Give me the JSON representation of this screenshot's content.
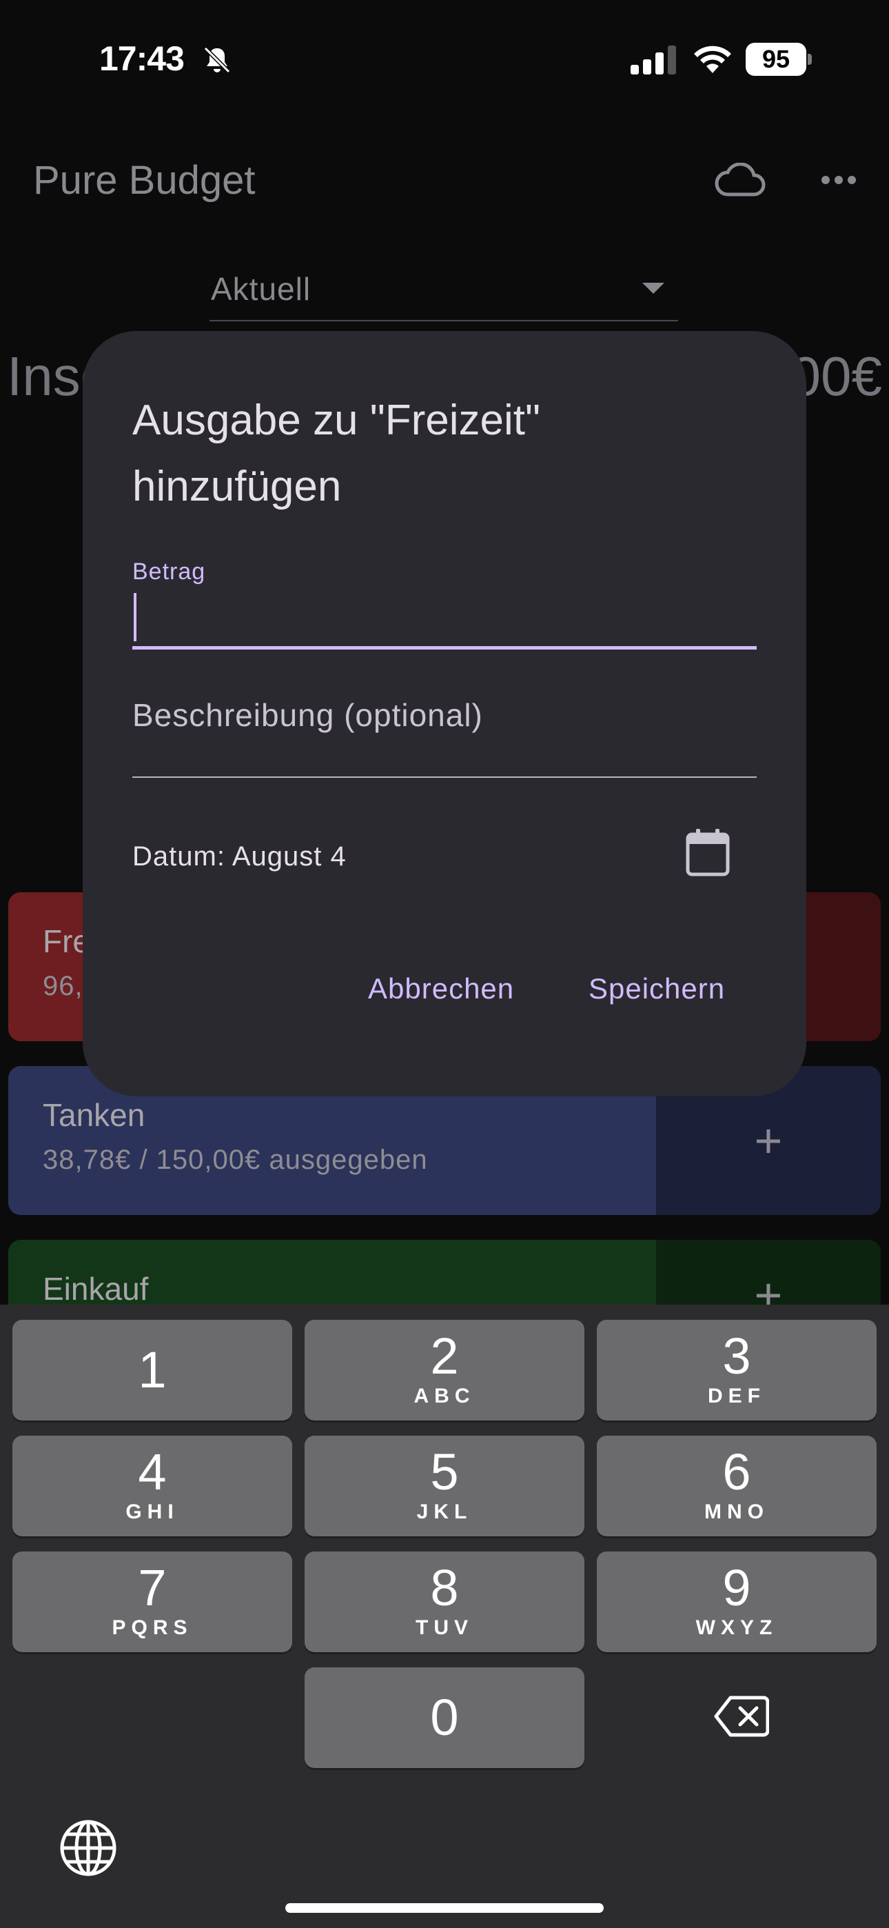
{
  "status_bar": {
    "time": "17:43",
    "battery": "95"
  },
  "app": {
    "title": "Pure Budget",
    "period": "Aktuell",
    "total_left": "Insg",
    "total_right": "00€"
  },
  "categories": [
    {
      "name": "Fre",
      "amount": "96,",
      "color": "#6e1e20"
    },
    {
      "name": "Tanken",
      "amount": "38,78€ / 150,00€ ausgegeben",
      "color": "#2c335a"
    },
    {
      "name": "Einkauf",
      "amount": "",
      "color": "#143618"
    }
  ],
  "dialog": {
    "title": "Ausgabe zu \"Freizeit\" hinzufügen",
    "amount_label": "Betrag",
    "amount_value": "",
    "description_placeholder": "Beschreibung (optional)",
    "date_text": "Datum: August 4",
    "cancel_label": "Abbrechen",
    "save_label": "Speichern",
    "accent_color": "#d0bcff"
  },
  "keyboard": {
    "keys": [
      {
        "num": "1",
        "letters": ""
      },
      {
        "num": "2",
        "letters": "ABC"
      },
      {
        "num": "3",
        "letters": "DEF"
      },
      {
        "num": "4",
        "letters": "GHI"
      },
      {
        "num": "5",
        "letters": "JKL"
      },
      {
        "num": "6",
        "letters": "MNO"
      },
      {
        "num": "7",
        "letters": "PQRS"
      },
      {
        "num": "8",
        "letters": "TUV"
      },
      {
        "num": "9",
        "letters": "WXYZ"
      },
      {
        "num": "0",
        "letters": ""
      }
    ],
    "plus_symbol": "+"
  },
  "icons": [
    "bell-slash-icon",
    "signal-icon",
    "wifi-icon",
    "cloud-icon",
    "more-icon",
    "dropdown-arrow-icon",
    "calendar-icon",
    "backspace-icon",
    "globe-icon"
  ]
}
